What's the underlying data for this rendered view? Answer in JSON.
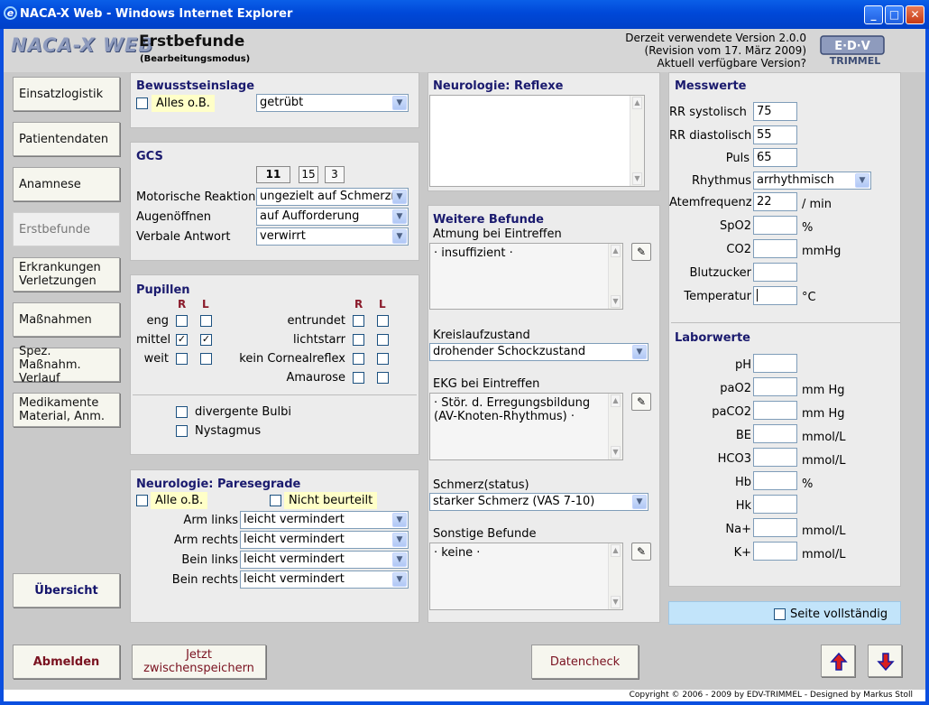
{
  "window": {
    "title": "NACA-X Web - Windows Internet Explorer"
  },
  "header": {
    "logo": "NACA-X WEB",
    "title": "Erstbefunde",
    "subtitle": "(Bearbeitungsmodus)",
    "version_line1": "Derzeit verwendete Version 2.0.0",
    "version_line2": "(Revision vom 17. März 2009)",
    "version_line3": "Aktuell verfügbare Version?",
    "edv_logo_text": "TRIMMEL"
  },
  "nav": {
    "items": [
      "Einsatzlogistik",
      "Patientendaten",
      "Anamnese",
      "Erstbefunde",
      "Erkrankungen Verletzungen",
      "Maßnahmen",
      "Spez. Maßnahm. Verlauf",
      "Medikamente Material, Anm."
    ],
    "overview": "Übersicht"
  },
  "bewusstseinslage": {
    "title": "Bewusstseinslage",
    "alles_ob": "Alles o.B.",
    "value": "getrübt"
  },
  "gcs": {
    "title": "GCS",
    "total": "11",
    "max": "15",
    "min": "3",
    "motor_label": "Motorische Reaktion",
    "motor_value": "ungezielt auf Schmerzr",
    "eyes_label": "Augenöffnen",
    "eyes_value": "auf Aufforderung",
    "verbal_label": "Verbale Antwort",
    "verbal_value": "verwirrt"
  },
  "pupillen": {
    "title": "Pupillen",
    "r": "R",
    "l": "L",
    "left_rows": [
      "eng",
      "mittel",
      "weit"
    ],
    "right_rows": [
      "entrundet",
      "lichtstarr",
      "kein Cornealreflex",
      "Amaurose"
    ],
    "divergent": "divergente Bulbi",
    "nystagmus": "Nystagmus"
  },
  "paresegrade": {
    "title": "Neurologie: Paresegrade",
    "alles_ob": "Alle o.B.",
    "nicht_beurteilt": "Nicht beurteilt",
    "rows": [
      {
        "label": "Arm links",
        "value": "leicht vermindert"
      },
      {
        "label": "Arm rechts",
        "value": "leicht vermindert"
      },
      {
        "label": "Bein links",
        "value": "leicht vermindert"
      },
      {
        "label": "Bein rechts",
        "value": "leicht vermindert"
      }
    ]
  },
  "reflexe": {
    "title": "Neurologie: Reflexe"
  },
  "weitere": {
    "title": "Weitere Befunde",
    "atmung_label": "Atmung bei Eintreffen",
    "atmung_value": "· insuffizient ·",
    "kreislauf_label": "Kreislaufzustand",
    "kreislauf_value": "drohender Schockzustand",
    "ekg_label": "EKG bei Eintreffen",
    "ekg_line1": "· Stör. d. Erregungsbildung",
    "ekg_line2": "(AV-Knoten-Rhythmus) ·",
    "schmerz_label": "Schmerz(status)",
    "schmerz_value": "starker Schmerz (VAS 7-10)",
    "sonstige_label": "Sonstige Befunde",
    "sonstige_value": "· keine ·"
  },
  "messwerte": {
    "title": "Messwerte",
    "rr_sys_label": "RR systolisch",
    "rr_sys": "75",
    "rr_dia_label": "RR diastolisch",
    "rr_dia": "55",
    "puls_label": "Puls",
    "puls": "65",
    "rhythmus_label": "Rhythmus",
    "rhythmus": "arrhythmisch",
    "af_label": "Atemfrequenz",
    "af": "22",
    "af_unit": "/ min",
    "spo2_label": "SpO2",
    "spo2_unit": "%",
    "co2_label": "CO2",
    "co2_unit": "mmHg",
    "bz_label": "Blutzucker",
    "temp_label": "Temperatur",
    "temp_unit": "°C"
  },
  "labor": {
    "title": "Laborwerte",
    "rows": [
      {
        "label": "pH",
        "unit": ""
      },
      {
        "label": "paO2",
        "unit": "mm Hg"
      },
      {
        "label": "paCO2",
        "unit": "mm Hg"
      },
      {
        "label": "BE",
        "unit": "mmol/L"
      },
      {
        "label": "HCO3",
        "unit": "mmol/L"
      },
      {
        "label": "Hb",
        "unit": "%"
      },
      {
        "label": "Hk",
        "unit": ""
      },
      {
        "label": "Na+",
        "unit": "mmol/L"
      },
      {
        "label": "K+",
        "unit": "mmol/L"
      }
    ]
  },
  "complete": {
    "label": "Seite vollständig"
  },
  "footer": {
    "abmelden": "Abmelden",
    "zwischenspeichern_1": "Jetzt",
    "zwischenspeichern_2": "zwischenspeichern",
    "datencheck": "Datencheck",
    "copyright": "Copyright © 2006 - 2009 by EDV-TRIMMEL - Designed by Markus Stoll"
  }
}
